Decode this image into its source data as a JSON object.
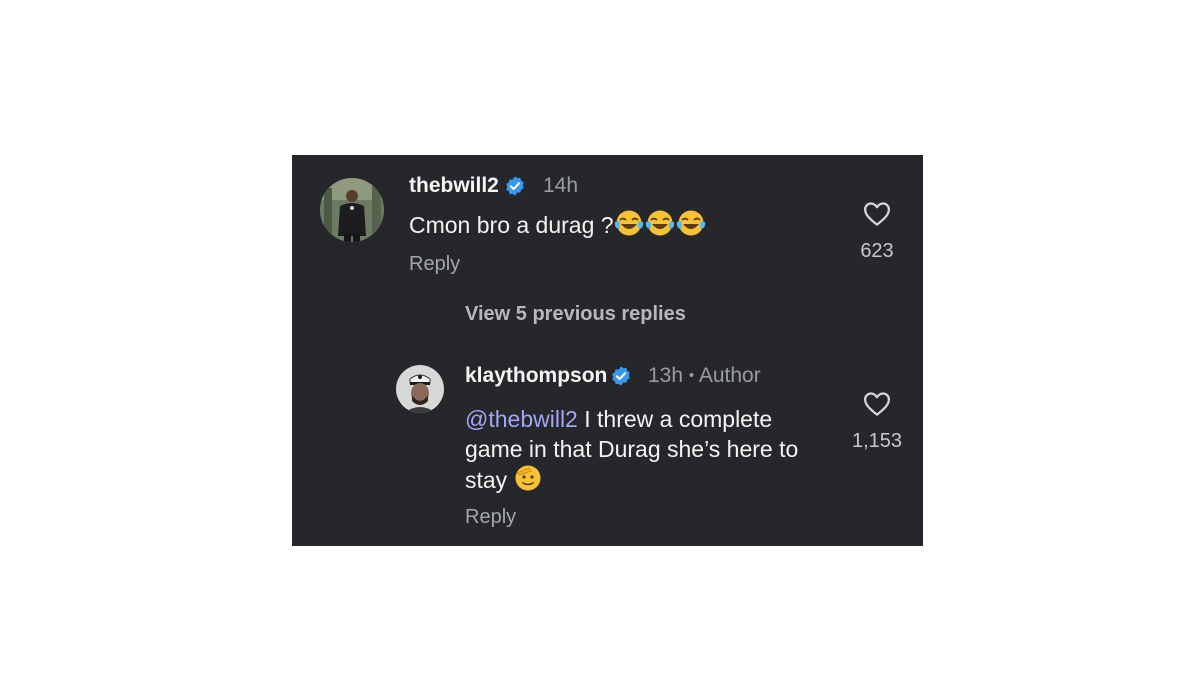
{
  "comments": [
    {
      "username": "thebwill2",
      "verified": true,
      "time": "14h",
      "text": "Cmon bro a durag ?",
      "emojis": [
        "joy",
        "joy",
        "joy"
      ],
      "reply_label": "Reply",
      "likes": "623"
    }
  ],
  "view_previous": "View 5 previous replies",
  "replies": [
    {
      "username": "klaythompson",
      "verified": true,
      "time": "13h",
      "separator": "•",
      "badge": "Author",
      "mention": "@thebwill2",
      "text": " I threw a complete game in that Durag she’s here to stay ",
      "emojis": [
        "saluting-face"
      ],
      "reply_label": "Reply",
      "likes": "1,153"
    }
  ],
  "colors": {
    "background": "#26272b",
    "verified_badge": "#3897f0",
    "mention": "#a3a6f5"
  },
  "icons": [
    "verified-badge-icon",
    "heart-outline-icon",
    "joy-emoji",
    "saluting-face-emoji"
  ]
}
